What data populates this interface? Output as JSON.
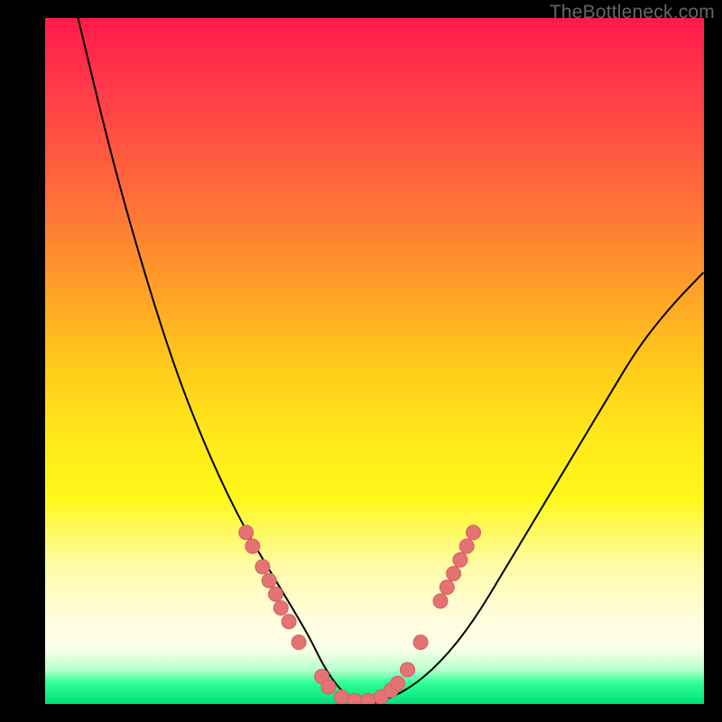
{
  "watermark": "TheBottleneck.com",
  "colors": {
    "background_black": "#000000",
    "gradient_top": "#ff1a4a",
    "gradient_bottom": "#00e07a",
    "curve": "#000000",
    "dot_fill": "#e57373"
  },
  "chart_data": {
    "type": "line",
    "title": "",
    "xlabel": "",
    "ylabel": "",
    "xlim": [
      0,
      100
    ],
    "ylim": [
      0,
      100
    ],
    "grid": false,
    "series": [
      {
        "name": "bottleneck-curve",
        "x": [
          5,
          10,
          15,
          20,
          25,
          30,
          35,
          40,
          42,
          44,
          46,
          48,
          50,
          55,
          60,
          65,
          70,
          75,
          80,
          85,
          90,
          95,
          100
        ],
        "y": [
          100,
          80,
          63,
          48,
          36,
          26,
          18,
          10,
          6,
          3,
          1,
          0,
          0,
          2,
          6,
          12,
          20,
          28,
          36,
          44,
          52,
          58,
          63
        ]
      }
    ],
    "scatter_points": {
      "name": "highlighted-dots",
      "points": [
        {
          "x": 30.5,
          "y": 25
        },
        {
          "x": 31.5,
          "y": 23
        },
        {
          "x": 33,
          "y": 20
        },
        {
          "x": 34,
          "y": 18
        },
        {
          "x": 35,
          "y": 16
        },
        {
          "x": 35.8,
          "y": 14
        },
        {
          "x": 37,
          "y": 12
        },
        {
          "x": 38.5,
          "y": 9
        },
        {
          "x": 42,
          "y": 4
        },
        {
          "x": 43,
          "y": 2.5
        },
        {
          "x": 45,
          "y": 1
        },
        {
          "x": 47,
          "y": 0.5
        },
        {
          "x": 49,
          "y": 0.5
        },
        {
          "x": 51,
          "y": 1
        },
        {
          "x": 52.5,
          "y": 2
        },
        {
          "x": 53.5,
          "y": 3
        },
        {
          "x": 55,
          "y": 5
        },
        {
          "x": 57,
          "y": 9
        },
        {
          "x": 60,
          "y": 15
        },
        {
          "x": 61,
          "y": 17
        },
        {
          "x": 62,
          "y": 19
        },
        {
          "x": 63,
          "y": 21
        },
        {
          "x": 64,
          "y": 23
        },
        {
          "x": 65,
          "y": 25
        }
      ]
    }
  }
}
